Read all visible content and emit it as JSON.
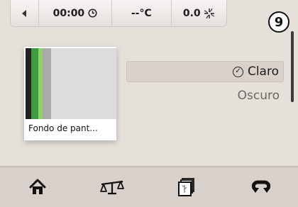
{
  "status_bar": {
    "back_icon": "chevron-left-icon",
    "time": "00:00",
    "clock_icon": "clock-icon",
    "temperature": "--°C",
    "fan_speed": "0.0",
    "fan_icon": "fan-icon"
  },
  "step_badge": "9",
  "wallpaper": {
    "label": "Fondo de pant...",
    "stripe_colors": [
      "#222222",
      "#3f9a3c",
      "#8fd16a",
      "#aaaaaa",
      "#dcdcdc"
    ]
  },
  "theme_options": [
    {
      "label": "Claro",
      "selected": true
    },
    {
      "label": "Oscuro",
      "selected": false
    }
  ],
  "bottom_nav": [
    {
      "icon": "home-icon"
    },
    {
      "icon": "balance-icon"
    },
    {
      "icon": "wallpaper-gallery-icon"
    },
    {
      "icon": "return-icon"
    }
  ],
  "colors": {
    "background": "#e6e0db",
    "selected_option": "#d9d2cc",
    "bottom_bar": "#d8d1cb"
  }
}
